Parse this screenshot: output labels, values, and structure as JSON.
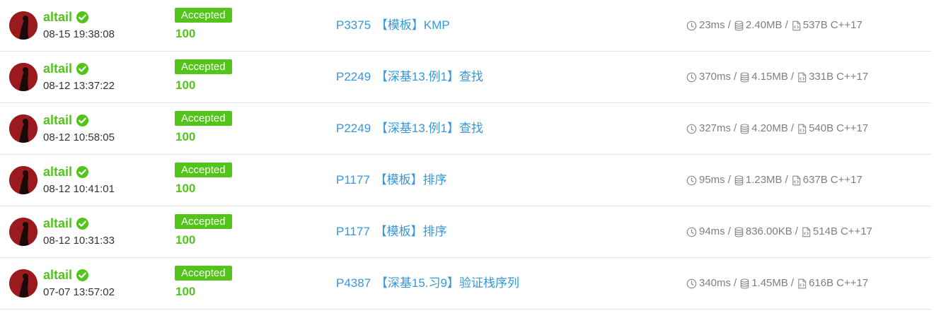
{
  "records": [
    {
      "user": "altail",
      "time": "08-15 19:38:08",
      "status": "Accepted",
      "score": "100",
      "pid": "P3375",
      "title": "【模板】KMP",
      "runtime": "23ms",
      "memory": "2.40MB",
      "code_size": "537B",
      "lang": "C++17"
    },
    {
      "user": "altail",
      "time": "08-12 13:37:22",
      "status": "Accepted",
      "score": "100",
      "pid": "P2249",
      "title": "【深基13.例1】查找",
      "runtime": "370ms",
      "memory": "4.15MB",
      "code_size": "331B",
      "lang": "C++17"
    },
    {
      "user": "altail",
      "time": "08-12 10:58:05",
      "status": "Accepted",
      "score": "100",
      "pid": "P2249",
      "title": "【深基13.例1】查找",
      "runtime": "327ms",
      "memory": "4.20MB",
      "code_size": "540B",
      "lang": "C++17"
    },
    {
      "user": "altail",
      "time": "08-12 10:41:01",
      "status": "Accepted",
      "score": "100",
      "pid": "P1177",
      "title": "【模板】排序",
      "runtime": "95ms",
      "memory": "1.23MB",
      "code_size": "637B",
      "lang": "C++17"
    },
    {
      "user": "altail",
      "time": "08-12 10:31:33",
      "status": "Accepted",
      "score": "100",
      "pid": "P1177",
      "title": "【模板】排序",
      "runtime": "94ms",
      "memory": "836.00KB",
      "code_size": "514B",
      "lang": "C++17"
    },
    {
      "user": "altail",
      "time": "07-07 13:57:02",
      "status": "Accepted",
      "score": "100",
      "pid": "P4387",
      "title": "【深基15.习9】验证栈序列",
      "runtime": "340ms",
      "memory": "1.45MB",
      "code_size": "616B",
      "lang": "C++17"
    }
  ],
  "separator": "/",
  "icons": {
    "verified": "check-circle-icon",
    "time": "clock-icon",
    "memory": "database-icon",
    "code": "file-code-icon"
  },
  "colors": {
    "accepted": "#52c41a",
    "link": "#3498db",
    "meta": "#7f7f7f",
    "avatar": "#9b1a1e"
  }
}
